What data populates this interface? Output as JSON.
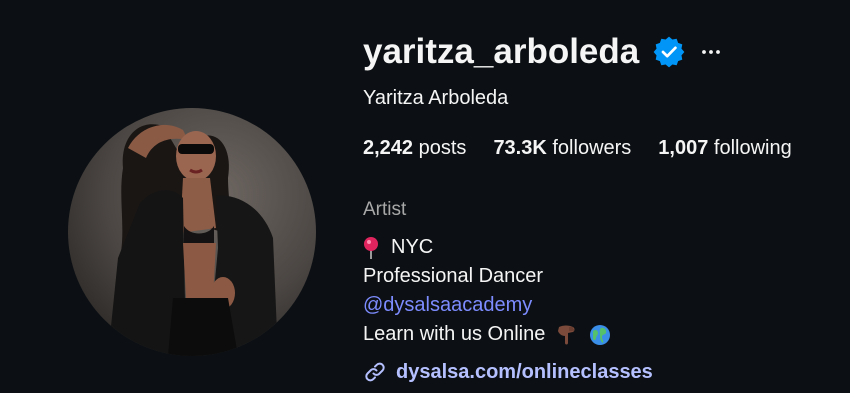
{
  "profile": {
    "username": "yaritza_arboleda",
    "verified_icon": "verified-badge-icon",
    "more_icon": "more-options-icon",
    "full_name": "Yaritza Arboleda"
  },
  "stats": {
    "posts_count": "2,242",
    "posts_label": "posts",
    "followers_count": "73.3K",
    "followers_label": "followers",
    "following_count": "1,007",
    "following_label": "following"
  },
  "bio": {
    "category": "Artist",
    "location_icon": "round-pushpin-icon",
    "location": "NYC",
    "line2": "Professional Dancer",
    "mention": "@dysalsaacademy",
    "line4": "Learn with us Online",
    "emoji_1": "pointing-down-hand-icon",
    "emoji_2": "globe-icon",
    "link_icon": "link-icon",
    "link": "dysalsa.com/onlineclasses"
  },
  "colors": {
    "background": "#0c1014",
    "text": "#f5f5f5",
    "secondary_text": "#a8a8a8",
    "verified_blue": "#0095f6",
    "mention": "#7d8cff",
    "link": "#b5c0ff"
  }
}
